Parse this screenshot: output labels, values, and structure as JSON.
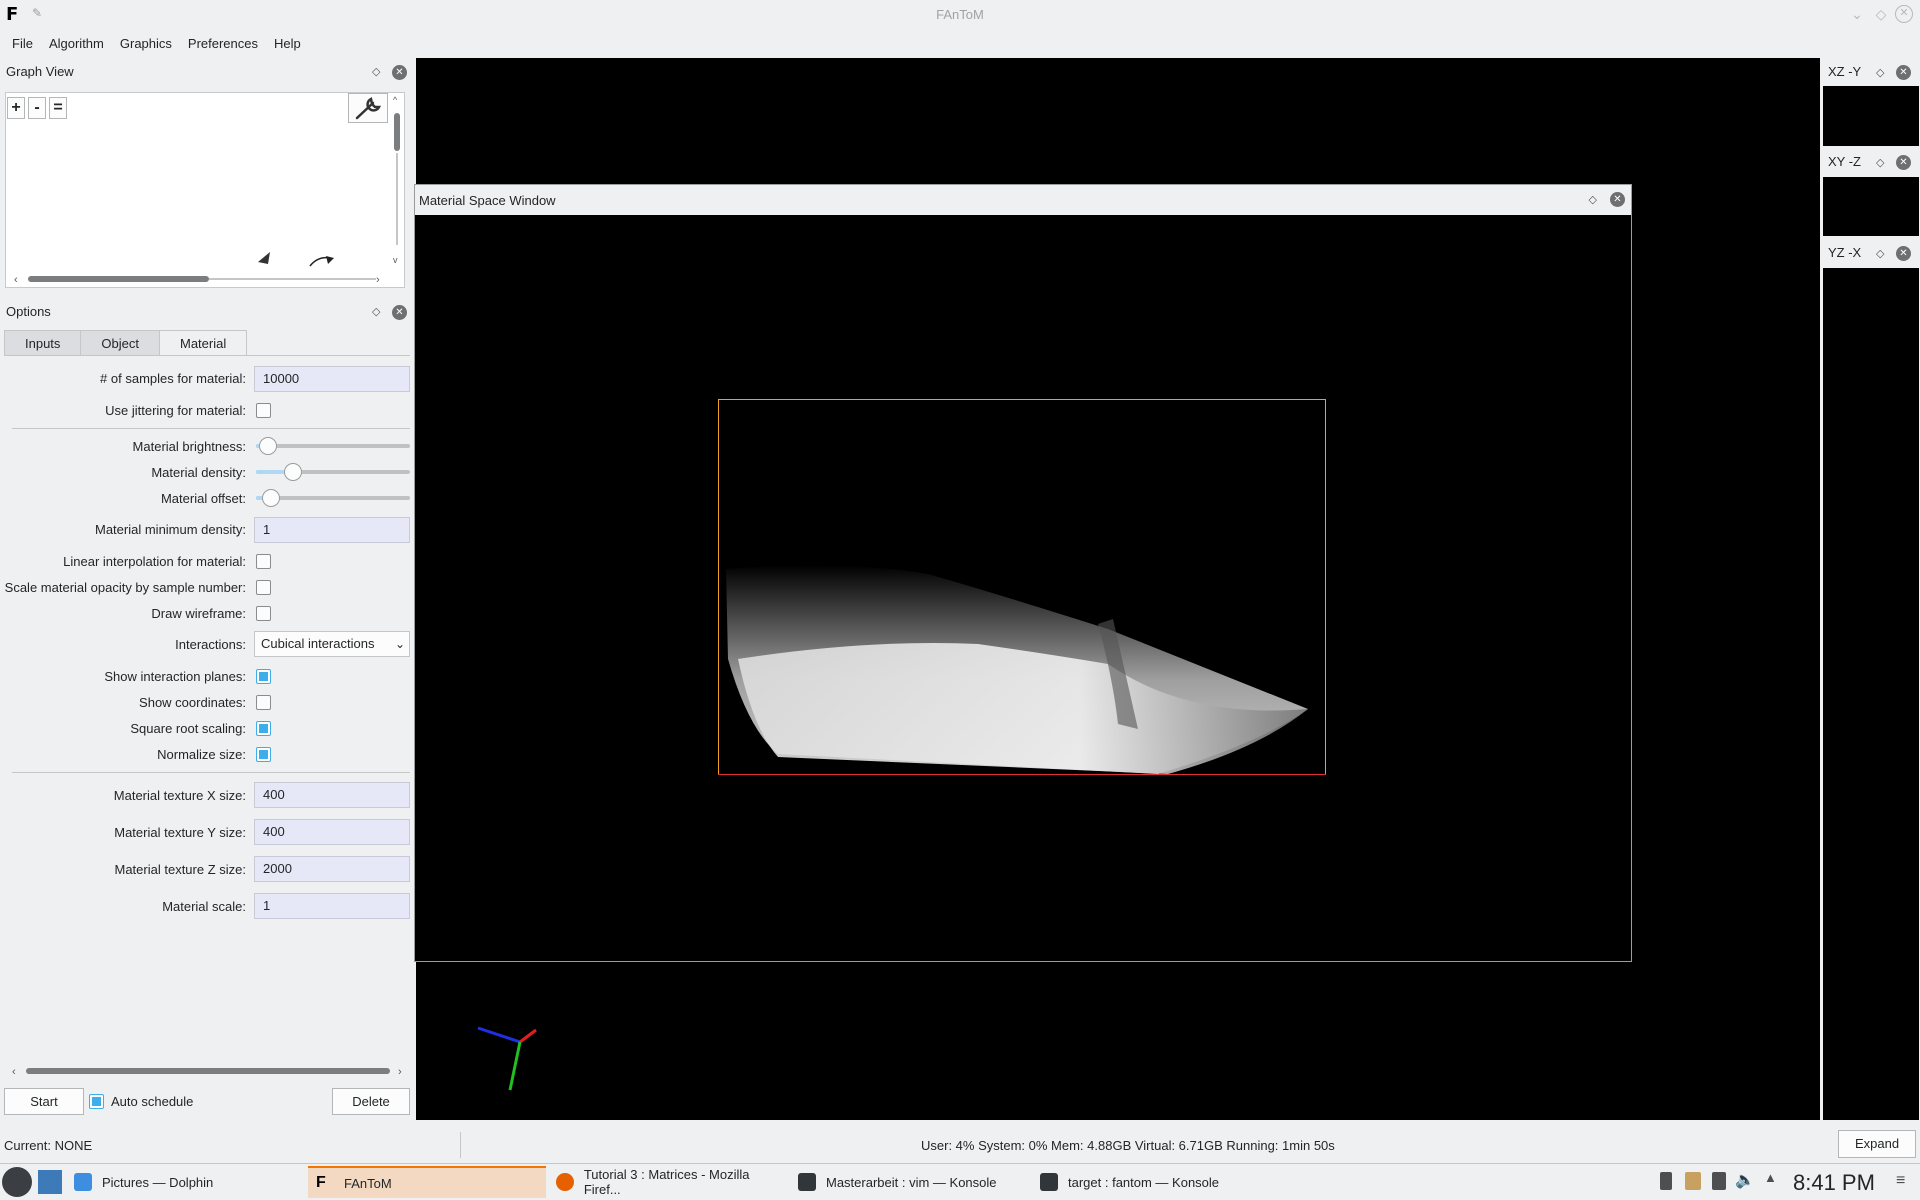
{
  "window": {
    "title": "FAnToM"
  },
  "menubar": {
    "items": [
      "File",
      "Algorithm",
      "Graphics",
      "Preferences",
      "Help"
    ]
  },
  "graph_view": {
    "title": "Graph View",
    "zoom_in": "+",
    "zoom_out": "-",
    "zoom_reset": "="
  },
  "options": {
    "title": "Options",
    "tabs": [
      "Inputs",
      "Object",
      "Material"
    ],
    "active_tab": "Material",
    "samples_label": "# of samples for material:",
    "samples_value": "10000",
    "jitter_label": "Use jittering for material:",
    "jitter_checked": false,
    "brightness_label": "Material brightness:",
    "brightness_value": 0.08,
    "density_label": "Material density:",
    "density_value": 0.24,
    "offset_label": "Material offset:",
    "offset_value": 0.1,
    "min_density_label": "Material minimum density:",
    "min_density_value": "1",
    "linear_interp_label": "Linear interpolation for material:",
    "linear_interp_checked": false,
    "scale_opacity_label": "Scale material opacity by sample number:",
    "scale_opacity_checked": false,
    "wireframe_label": "Draw wireframe:",
    "wireframe_checked": false,
    "interactions_label": "Interactions:",
    "interactions_value": "Cubical interactions",
    "show_planes_label": "Show interaction planes:",
    "show_planes_checked": true,
    "show_coords_label": "Show coordinates:",
    "show_coords_checked": false,
    "sqrt_scaling_label": "Square root scaling:",
    "sqrt_scaling_checked": true,
    "normalize_label": "Normalize size:",
    "normalize_checked": true,
    "tex_x_label": "Material texture X size:",
    "tex_x_value": "400",
    "tex_y_label": "Material texture Y size:",
    "tex_y_value": "400",
    "tex_z_label": "Material texture Z size:",
    "tex_z_value": "2000",
    "scale_label": "Material scale:",
    "scale_value": "1"
  },
  "controls": {
    "start": "Start",
    "auto_schedule": "Auto schedule",
    "auto_schedule_checked": true,
    "delete": "Delete"
  },
  "material_window": {
    "title": "Material Space Window"
  },
  "mini_views": [
    "XZ -Y",
    "XY -Z",
    "YZ -X"
  ],
  "status": {
    "current": "Current: NONE",
    "stats": "User: 4% System: 0%  Mem: 4.88GB Virtual: 6.71GB Running: 1min 50s",
    "expand": "Expand"
  },
  "taskbar": {
    "tasks": [
      "Pictures — Dolphin",
      "FAnToM",
      "Tutorial 3 : Matrices - Mozilla Firef...",
      "Masterarbeit : vim — Konsole",
      "target : fantom — Konsole"
    ],
    "clock": "8:41 PM"
  },
  "colors": {
    "accent": "#3daee9",
    "active_task": "#f67400",
    "axis_x": "#e02020",
    "axis_y": "#20c020",
    "axis_z": "#2030e0"
  }
}
